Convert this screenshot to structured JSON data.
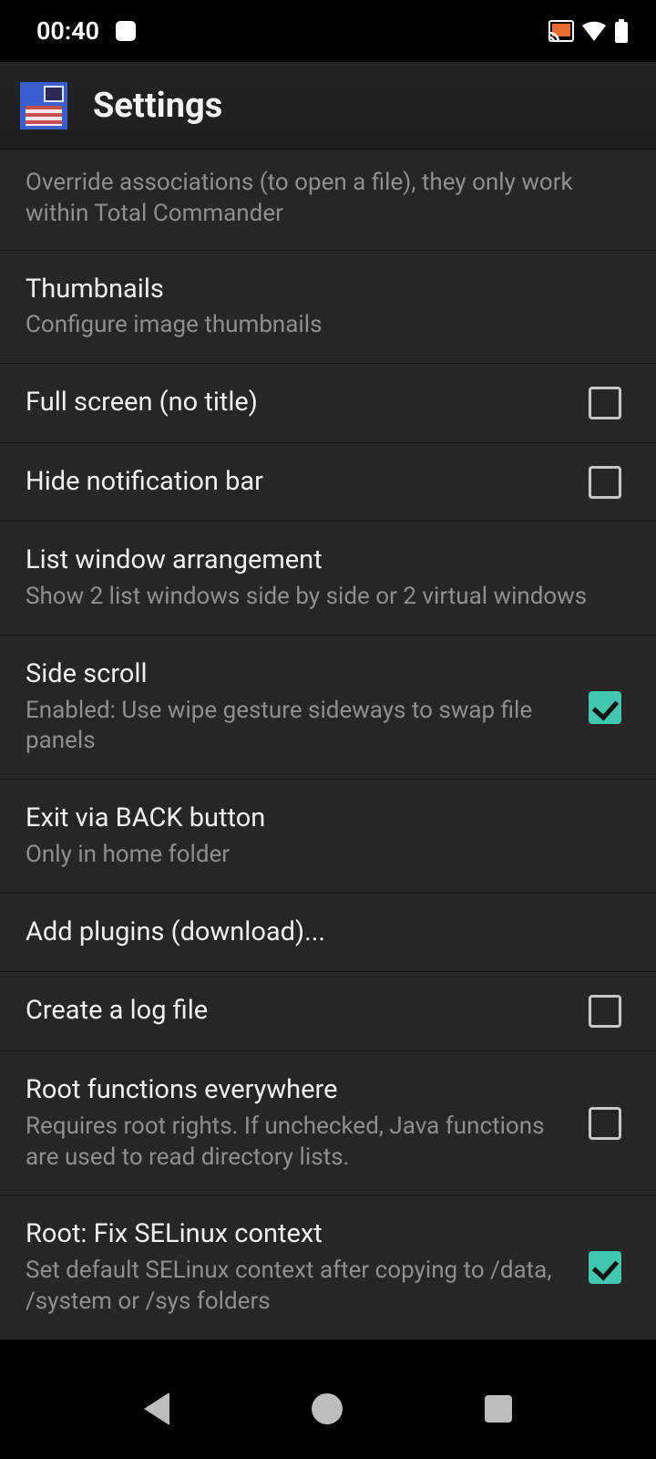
{
  "status": {
    "time": "00:40"
  },
  "header": {
    "title": "Settings"
  },
  "items": {
    "override": {
      "sub": "Override associations (to open a file), they only work within Total Commander"
    },
    "thumbnails": {
      "title": "Thumbnails",
      "sub": "Configure image thumbnails"
    },
    "fullscreen": {
      "title": "Full screen (no title)"
    },
    "hidenotif": {
      "title": "Hide notification bar"
    },
    "listwin": {
      "title": "List window arrangement",
      "sub": "Show 2 list windows side by side or 2 virtual windows"
    },
    "sidescroll": {
      "title": "Side scroll",
      "sub": "Enabled: Use wipe gesture sideways to swap file panels"
    },
    "exitback": {
      "title": "Exit via BACK button",
      "sub": "Only in home folder"
    },
    "addplugins": {
      "title": "Add plugins (download)..."
    },
    "logfile": {
      "title": "Create a log file"
    },
    "roote": {
      "title": "Root functions everywhere",
      "sub": "Requires root rights. If unchecked, Java functions are used to read directory lists."
    },
    "selinux": {
      "title": "Root: Fix SELinux context",
      "sub": "Set default SELinux context after copying to /data, /system or /sys folders"
    }
  }
}
